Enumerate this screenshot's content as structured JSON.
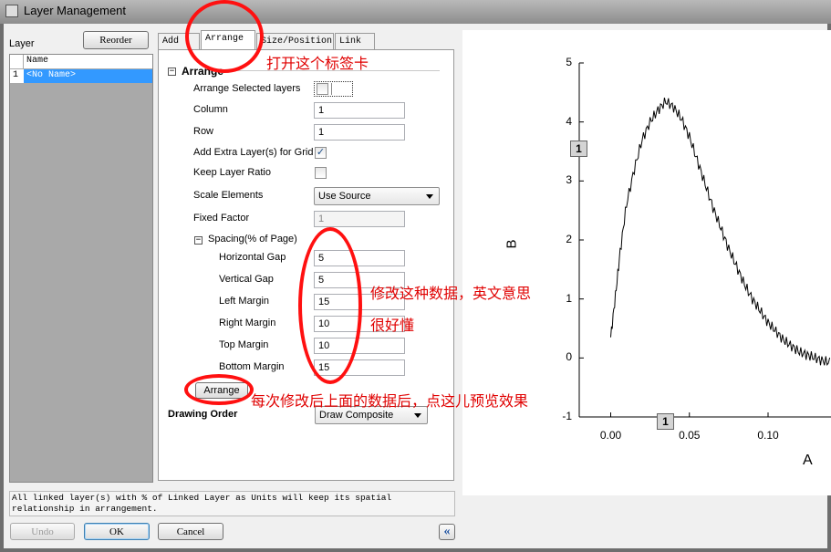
{
  "window": {
    "title": "Layer Management"
  },
  "left_panel": {
    "label": "Layer",
    "reorder_button": "Reorder",
    "list_header": "Name",
    "rows": [
      {
        "index": "1",
        "name": "<No Name>"
      }
    ]
  },
  "tabs": [
    {
      "label": "Add"
    },
    {
      "label": "Arrange"
    },
    {
      "label": "Size/Position"
    },
    {
      "label": "Link"
    }
  ],
  "arrange": {
    "section_title": "Arrange",
    "arrange_selected_label": "Arrange Selected layers",
    "column_label": "Column",
    "column_value": "1",
    "row_label": "Row",
    "row_value": "1",
    "add_extra_label": "Add Extra Layer(s) for Grid",
    "add_extra_checked": true,
    "keep_ratio_label": "Keep Layer Ratio",
    "keep_ratio_checked": false,
    "scale_label": "Scale Elements",
    "scale_value": "Use Source",
    "fixed_factor_label": "Fixed Factor",
    "fixed_factor_value": "1",
    "spacing_label": "Spacing(% of Page)",
    "hgap_label": "Horizontal Gap",
    "hgap_value": "5",
    "vgap_label": "Vertical Gap",
    "vgap_value": "5",
    "left_label": "Left Margin",
    "left_value": "15",
    "right_label": "Right Margin",
    "right_value": "10",
    "top_label": "Top Margin",
    "top_value": "10",
    "bottom_label": "Bottom Margin",
    "bottom_value": "15",
    "arrange_button": "Arrange",
    "drawing_order_label": "Drawing Order",
    "drawing_order_value": "Draw Composite"
  },
  "info_text_1": "All linked layer(s) with % of Linked Layer as Units will keep its spatial",
  "info_text_2": "relationship in arrangement.",
  "buttons": {
    "undo": "Undo",
    "ok": "OK",
    "cancel": "Cancel",
    "collapse": "«"
  },
  "annotations": {
    "open_tab": "打开这个标签卡",
    "modify_data_1": "修改这种数据，英文意思",
    "modify_data_2": "很好懂",
    "preview": "每次修改后上面的数据后，点这儿预览效果"
  },
  "preview_graph": {
    "ylabel": "B",
    "xlabel": "A",
    "y_ticks": [
      "5",
      "4",
      "3",
      "2",
      "1",
      "0",
      "-1"
    ],
    "x_ticks": [
      "0.00",
      "0.05",
      "0.10"
    ],
    "layer_badge": "1",
    "line_color": "#000000"
  },
  "chart_data": {
    "type": "line",
    "xlabel": "A",
    "ylabel": "B",
    "xlim": [
      -0.02,
      0.14
    ],
    "ylim": [
      -1,
      5
    ],
    "x_ticks": [
      0.0,
      0.05,
      0.1
    ],
    "y_ticks": [
      -1,
      0,
      1,
      2,
      3,
      4,
      5
    ],
    "series": [
      {
        "x": [
          0.0,
          0.003,
          0.006,
          0.01,
          0.015,
          0.02,
          0.025,
          0.03,
          0.035,
          0.04,
          0.045,
          0.05,
          0.055,
          0.06,
          0.065,
          0.07,
          0.075,
          0.08,
          0.085,
          0.09,
          0.095,
          0.1,
          0.105,
          0.11,
          0.115,
          0.12,
          0.125,
          0.13,
          0.135,
          0.14
        ],
        "y": [
          0.35,
          1.05,
          1.8,
          2.6,
          3.2,
          3.7,
          4.0,
          4.2,
          4.35,
          4.25,
          4.05,
          3.75,
          3.35,
          2.95,
          2.55,
          2.2,
          1.85,
          1.55,
          1.25,
          1.0,
          0.8,
          0.6,
          0.45,
          0.3,
          0.2,
          0.1,
          0.05,
          0.0,
          -0.05,
          -0.08
        ]
      }
    ]
  }
}
